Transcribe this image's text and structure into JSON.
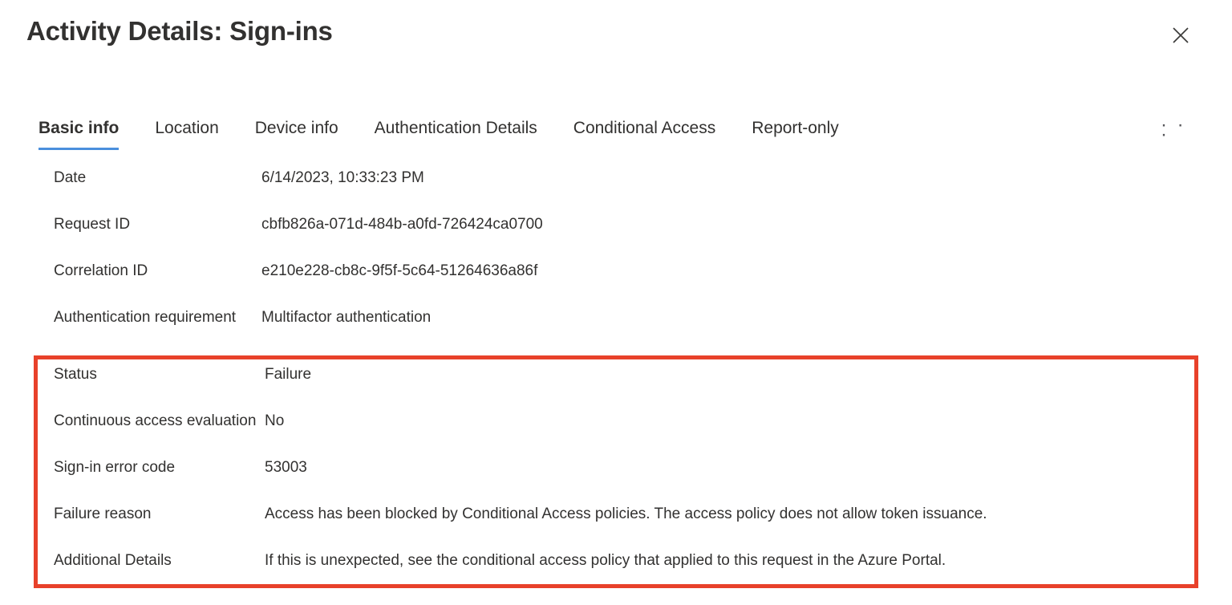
{
  "header": {
    "title": "Activity Details: Sign-ins",
    "close_icon": "close-icon"
  },
  "tabs": {
    "items": [
      {
        "label": "Basic info",
        "active": true
      },
      {
        "label": "Location",
        "active": false
      },
      {
        "label": "Device info",
        "active": false
      },
      {
        "label": "Authentication Details",
        "active": false
      },
      {
        "label": "Conditional Access",
        "active": false
      },
      {
        "label": "Report-only",
        "active": false
      }
    ],
    "overflow_label": "· · ·",
    "active_underline_color": "#4a8fdd"
  },
  "details": {
    "top_rows": [
      {
        "label": "Date",
        "value": "6/14/2023, 10:33:23 PM"
      },
      {
        "label": "Request ID",
        "value": "cbfb826a-071d-484b-a0fd-726424ca0700"
      },
      {
        "label": "Correlation ID",
        "value": "e210e228-cb8c-9f5f-5c64-51264636a86f"
      },
      {
        "label": "Authentication requirement",
        "value": "Multifactor authentication"
      }
    ],
    "highlighted_rows": [
      {
        "label": "Status",
        "value": "Failure"
      },
      {
        "label": "Continuous access evaluation",
        "value": "No"
      },
      {
        "label": "Sign-in error code",
        "value": "53003"
      },
      {
        "label": "Failure reason",
        "value": "Access has been blocked by Conditional Access policies. The access policy does not allow token issuance."
      },
      {
        "label": "Additional Details",
        "value": "If this is unexpected, see the conditional access policy that applied to this request in the Azure Portal."
      }
    ],
    "highlight_color": "#e8412a"
  }
}
